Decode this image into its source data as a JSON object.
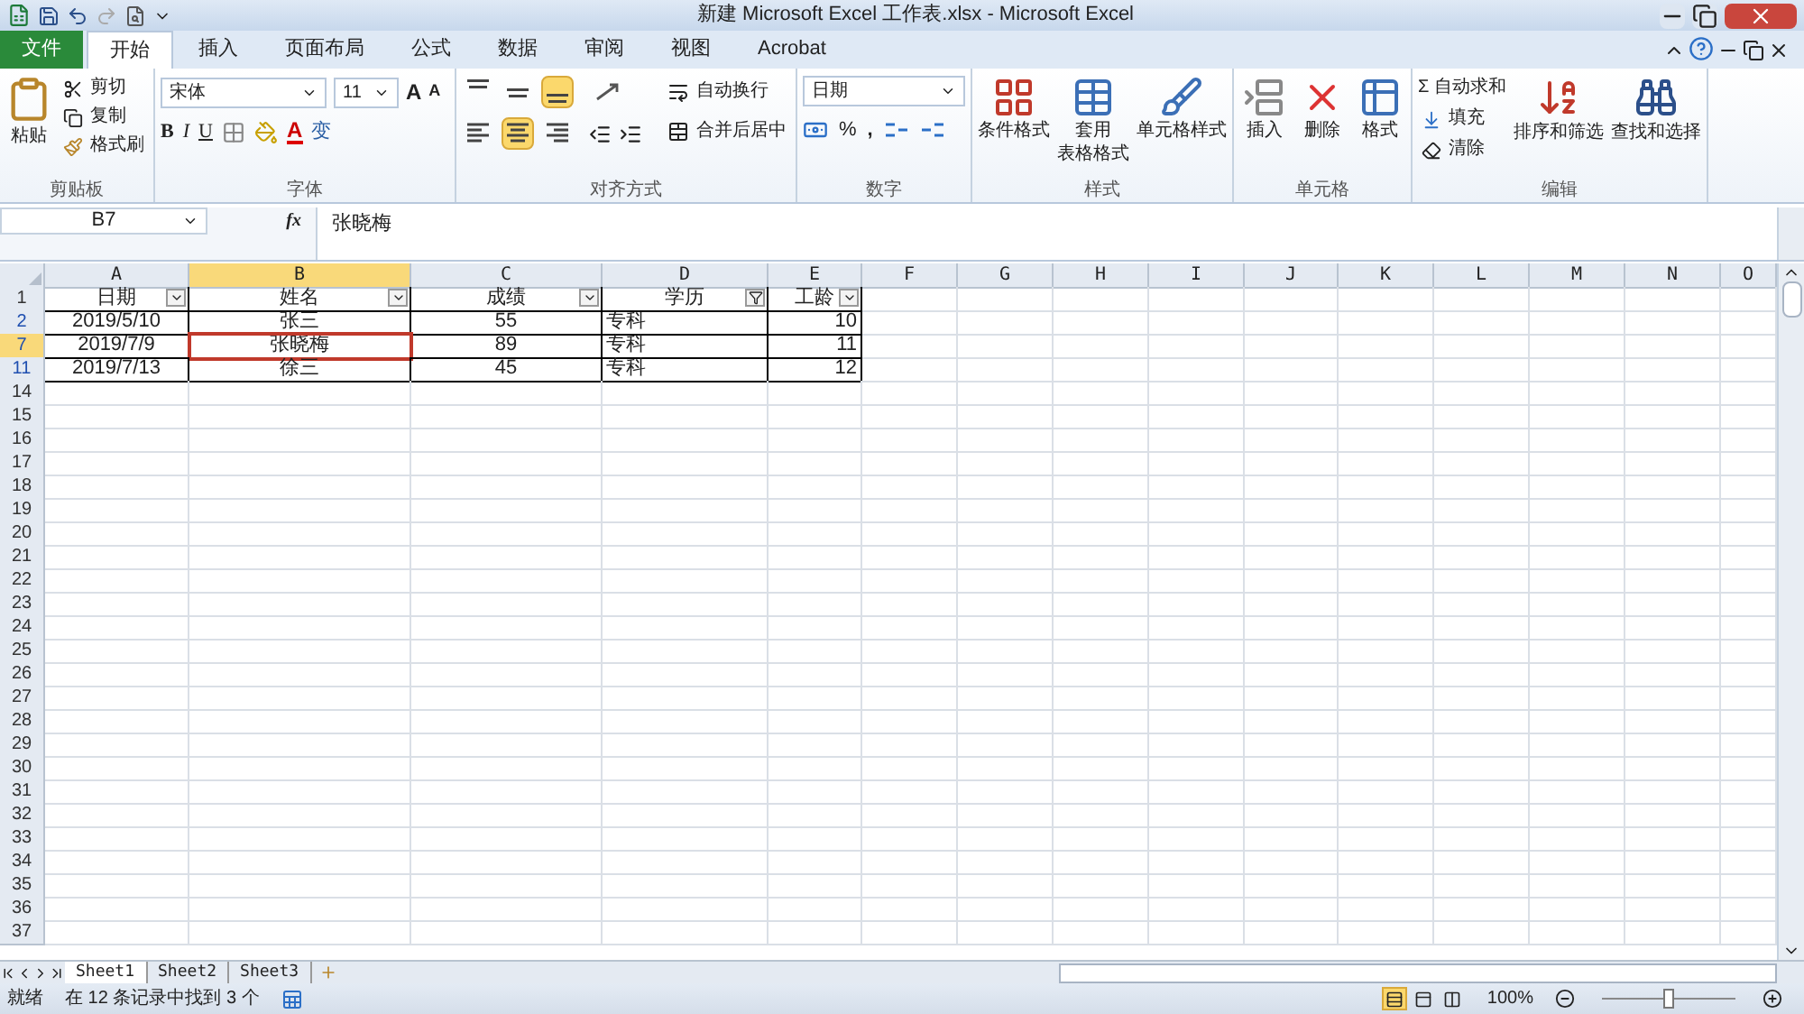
{
  "window": {
    "title": "新建 Microsoft Excel 工作表.xlsx - Microsoft Excel"
  },
  "tabs": [
    {
      "label": "文件",
      "kind": "file",
      "selected": false
    },
    {
      "label": "开始",
      "kind": "tab",
      "selected": true
    },
    {
      "label": "插入",
      "kind": "tab",
      "selected": false
    },
    {
      "label": "页面布局",
      "kind": "tab",
      "selected": false
    },
    {
      "label": "公式",
      "kind": "tab",
      "selected": false
    },
    {
      "label": "数据",
      "kind": "tab",
      "selected": false
    },
    {
      "label": "审阅",
      "kind": "tab",
      "selected": false
    },
    {
      "label": "视图",
      "kind": "tab",
      "selected": false
    },
    {
      "label": "Acrobat",
      "kind": "tab",
      "selected": false
    }
  ],
  "ribbon": {
    "clipboard": {
      "title": "剪贴板",
      "paste": "粘贴",
      "cut": "剪切",
      "copy": "复制",
      "format_painter": "格式刷"
    },
    "font": {
      "title": "字体",
      "name": "宋体",
      "size": "11",
      "grow": "A",
      "shrink": "A",
      "bold": "B",
      "italic": "I",
      "underline": "U",
      "color_letter": "A",
      "phonetic": "变"
    },
    "alignment": {
      "title": "对齐方式",
      "vertical": [
        {
          "selected": false
        },
        {
          "selected": false
        },
        {
          "selected": true
        }
      ],
      "horizontal": [
        {
          "selected": false
        },
        {
          "selected": true
        },
        {
          "selected": false
        }
      ],
      "wrap": "自动换行",
      "merge": "合并后居中"
    },
    "number": {
      "title": "数字",
      "format": "日期",
      "percent": "%",
      "comma": ","
    },
    "styles": {
      "title": "样式",
      "buttons": [
        {
          "lines": [
            "条件格式"
          ]
        },
        {
          "lines": [
            "套用",
            "表格格式"
          ]
        },
        {
          "lines": [
            "单元格样式"
          ]
        }
      ]
    },
    "cells": {
      "title": "单元格",
      "buttons": [
        {
          "label": "插入"
        },
        {
          "label": "删除"
        },
        {
          "label": "格式"
        }
      ]
    },
    "editing": {
      "title": "编辑",
      "sum_symbol": "Σ",
      "autosum": "自动求和",
      "fill": "填充",
      "clear": "清除",
      "sort": "排序和筛选",
      "find": "查找和选择"
    }
  },
  "formula_bar": {
    "name_box": "B7",
    "function_label": "fx",
    "value": "张晓梅"
  },
  "grid": {
    "columns": [
      {
        "letter": "A",
        "selected": false
      },
      {
        "letter": "B",
        "selected": true
      },
      {
        "letter": "C",
        "selected": false
      },
      {
        "letter": "D",
        "selected": false
      },
      {
        "letter": "E",
        "selected": false
      },
      {
        "letter": "F",
        "selected": false
      },
      {
        "letter": "G",
        "selected": false
      },
      {
        "letter": "H",
        "selected": false
      },
      {
        "letter": "I",
        "selected": false
      },
      {
        "letter": "J",
        "selected": false
      },
      {
        "letter": "K",
        "selected": false
      },
      {
        "letter": "L",
        "selected": false
      },
      {
        "letter": "M",
        "selected": false
      },
      {
        "letter": "N",
        "selected": false
      },
      {
        "letter": "O",
        "selected": false
      }
    ],
    "header_row": {
      "number": "1",
      "cells": [
        {
          "text": "日期",
          "filter_active": false
        },
        {
          "text": "姓名",
          "filter_active": false
        },
        {
          "text": "成绩",
          "filter_active": false
        },
        {
          "text": "学历",
          "filter_active": true
        },
        {
          "text": "工龄",
          "filter_active": false
        }
      ]
    },
    "rows": [
      {
        "number": "2",
        "filtered": true,
        "selected": false,
        "cells": [
          {
            "text": "2019/5/10",
            "selected": false
          },
          {
            "text": "张三",
            "selected": false
          },
          {
            "text": "55",
            "selected": false
          },
          {
            "text": "专科",
            "selected": false
          },
          {
            "text": "10",
            "selected": false
          }
        ]
      },
      {
        "number": "7",
        "filtered": true,
        "selected": true,
        "cells": [
          {
            "text": "2019/7/9",
            "selected": false
          },
          {
            "text": "张晓梅",
            "selected": true
          },
          {
            "text": "89",
            "selected": false
          },
          {
            "text": "专科",
            "selected": false
          },
          {
            "text": "11",
            "selected": false
          }
        ]
      },
      {
        "number": "11",
        "filtered": true,
        "selected": false,
        "cells": [
          {
            "text": "2019/7/13",
            "selected": false
          },
          {
            "text": "徐三",
            "selected": false
          },
          {
            "text": "45",
            "selected": false
          },
          {
            "text": "专科",
            "selected": false
          },
          {
            "text": "12",
            "selected": false
          }
        ]
      }
    ],
    "empty_rows": [
      "14",
      "15",
      "16",
      "17",
      "18",
      "19",
      "20",
      "21",
      "22",
      "23",
      "24",
      "25",
      "26",
      "27",
      "28",
      "29",
      "30",
      "31",
      "32",
      "33",
      "34",
      "35",
      "36",
      "37"
    ]
  },
  "sheets": [
    {
      "label": "Sheet1",
      "selected": true
    },
    {
      "label": "Sheet2",
      "selected": false
    },
    {
      "label": "Sheet3",
      "selected": false
    }
  ],
  "status_bar": {
    "ready": "就绪",
    "message": "在 12 条记录中找到 3 个",
    "views": [
      {
        "selected": true
      },
      {
        "selected": false
      },
      {
        "selected": false
      }
    ],
    "zoom": "100%",
    "zoom_slider": {
      "level": 0.5
    }
  }
}
